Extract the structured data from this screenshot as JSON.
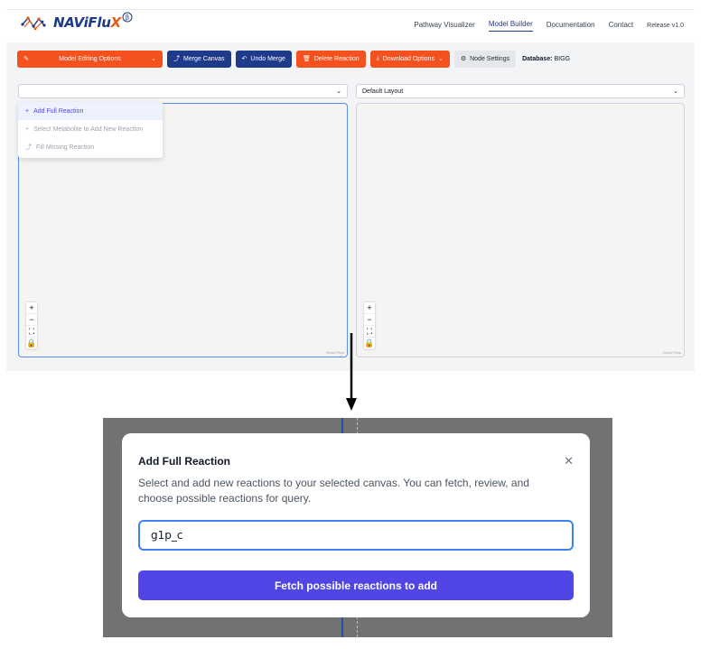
{
  "app": {
    "logo_text_prefix": "NAViFlu",
    "logo_text_x": "X",
    "logo_badge": "β"
  },
  "nav": {
    "links": [
      "Pathway Visualizer",
      "Model Builder",
      "Documentation",
      "Contact"
    ],
    "active": "Model Builder",
    "release": "Release v1.0"
  },
  "toolbar": {
    "model_editing_label": "Model Editing Options",
    "merge_canvas_label": "Merge Canvas",
    "undo_merge_label": "Undo Merge",
    "delete_reaction_label": "Delete Reaction",
    "download_options_label": "Download Options",
    "node_settings_label": "Node Settings",
    "database_label": "Database:",
    "database_value": "BIGG"
  },
  "dropdown": {
    "items": [
      {
        "icon": "+",
        "label": "Add Full Reaction"
      },
      {
        "icon": "+",
        "label": "Select Metabolite to Add New Reaction"
      },
      {
        "icon": "⤴",
        "label": "Fill Missing Reaction"
      }
    ]
  },
  "canvas": {
    "right_layout_value": "Default Layout",
    "attribution": "React Flow",
    "controls": [
      "+",
      "−",
      "⛶",
      "🔒"
    ]
  },
  "modal": {
    "title": "Add Full Reaction",
    "description": "Select and add new reactions to your selected canvas. You can fetch, review, and choose possible reactions for query.",
    "input_value": "g1p_c",
    "button_label": "Fetch possible reactions to add"
  },
  "colors": {
    "orange": "#f4511e",
    "navy": "#1e3a8a",
    "indigo": "#4f46e5",
    "focus_blue": "#3b82f6"
  }
}
